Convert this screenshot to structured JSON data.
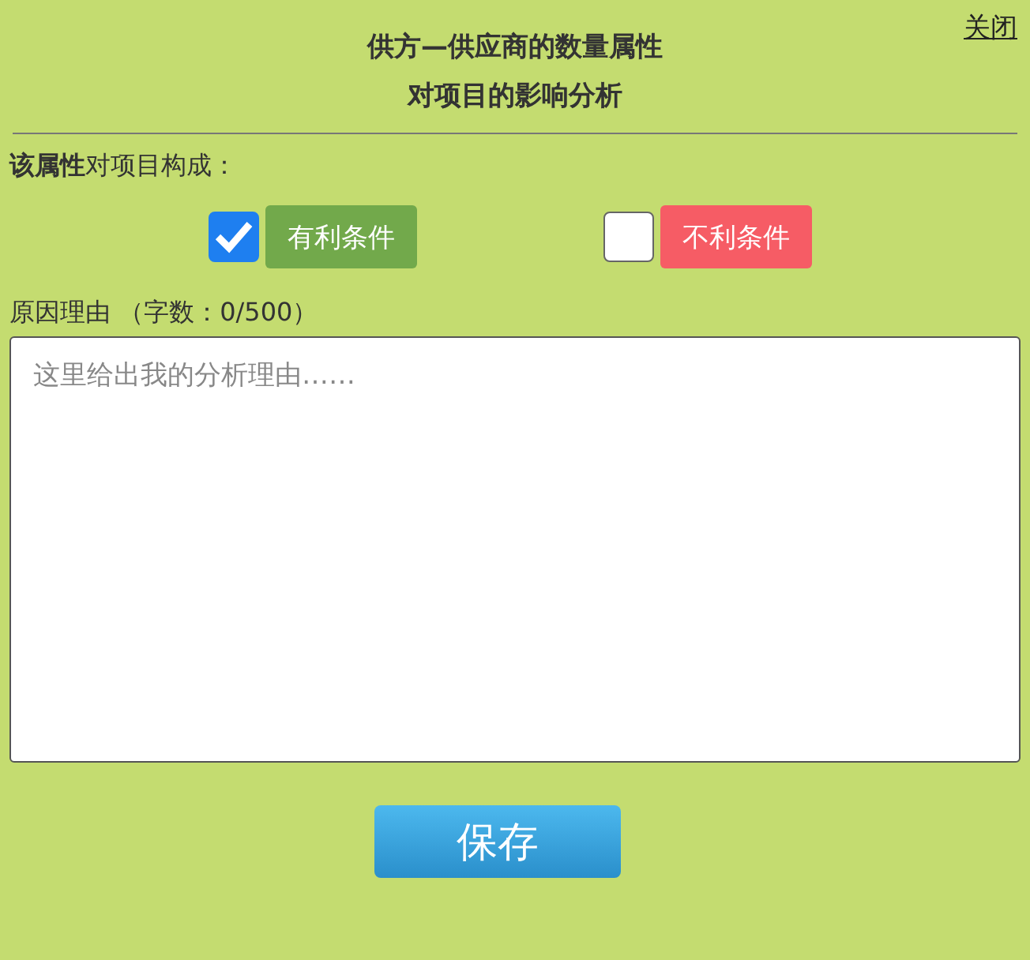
{
  "close_link": "关闭",
  "title_lines": [
    "供方—供应商的数量属性",
    "对项目的影响分析"
  ],
  "prompt": "**该属性**对项目构成：",
  "options": [
    {
      "label": "有利条件",
      "checked": true,
      "color": "#72a94b"
    },
    {
      "label": "不利条件",
      "checked": false,
      "color": "#f65c65"
    }
  ],
  "reason_label": "原因理由 （字数：0/500）",
  "reason_field": {
    "placeholder": "这里给出我的分析理由……"
  },
  "save_button": "保存"
}
